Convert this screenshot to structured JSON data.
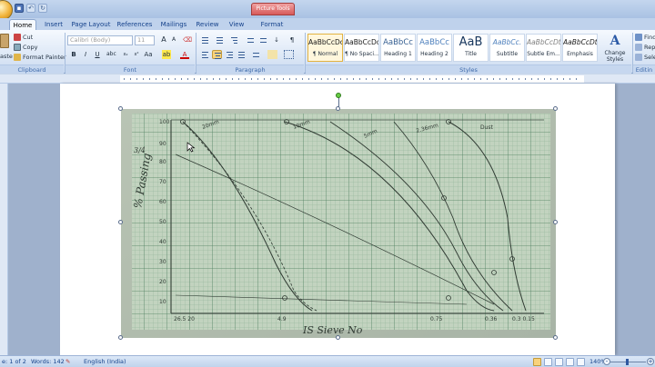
{
  "titlebar": {
    "context_tab_title": "Picture Tools"
  },
  "tabs": [
    {
      "label": "Home",
      "active": true
    },
    {
      "label": "Insert",
      "active": false
    },
    {
      "label": "Page Layout",
      "active": false
    },
    {
      "label": "References",
      "active": false
    },
    {
      "label": "Mailings",
      "active": false
    },
    {
      "label": "Review",
      "active": false
    },
    {
      "label": "View",
      "active": false
    },
    {
      "label": "Format",
      "active": false
    }
  ],
  "clipboard": {
    "paste_label": "aste",
    "cut_label": "Cut",
    "copy_label": "Copy",
    "format_painter_label": "Format Painter",
    "group_label": "Clipboard"
  },
  "font": {
    "font_name": "Calibri (Body)",
    "font_size": "11",
    "bold": "B",
    "italic": "I",
    "underline": "U",
    "group_label": "Font"
  },
  "paragraph": {
    "group_label": "Paragraph",
    "pilcrow": "¶"
  },
  "styles": {
    "group_label": "Styles",
    "items": [
      {
        "sample": "AaBbCcDc",
        "name": "¶ Normal",
        "selected": true
      },
      {
        "sample": "AaBbCcDc",
        "name": "¶ No Spaci...",
        "selected": false
      },
      {
        "sample": "AaBbCc",
        "name": "Heading 1",
        "selected": false
      },
      {
        "sample": "AaBbCc",
        "name": "Heading 2",
        "selected": false
      },
      {
        "sample": "AaB",
        "name": "Title",
        "selected": false
      },
      {
        "sample": "AaBbCc.",
        "name": "Subtitle",
        "selected": false
      },
      {
        "sample": "AaBbCcDt",
        "name": "Subtle Em...",
        "selected": false
      },
      {
        "sample": "AaBbCcDt",
        "name": "Emphasis",
        "selected": false
      }
    ],
    "change_styles_label": "Change Styles"
  },
  "editing": {
    "find_label": "Find",
    "replace_label": "Repl",
    "select_label": "Selec",
    "group_label": "Editin"
  },
  "picture": {
    "y_axis_label": "% Passing",
    "x_axis_label": "IS Sieve No",
    "side_label": "3/4",
    "tick_labels": [
      "100",
      "90",
      "80",
      "70",
      "60",
      "50",
      "40",
      "30",
      "20",
      "10"
    ],
    "x_ticks": [
      "26.5 20",
      "4.9",
      "0.75",
      "0.36",
      "0.3 0.15"
    ],
    "curve_labels": [
      "20mm",
      "10mm",
      "5mm",
      "2.36mm",
      "Dust"
    ]
  },
  "status": {
    "page": "e: 1 of 2",
    "words": "Words: 142",
    "language": "English (India)",
    "zoom": "140%"
  }
}
